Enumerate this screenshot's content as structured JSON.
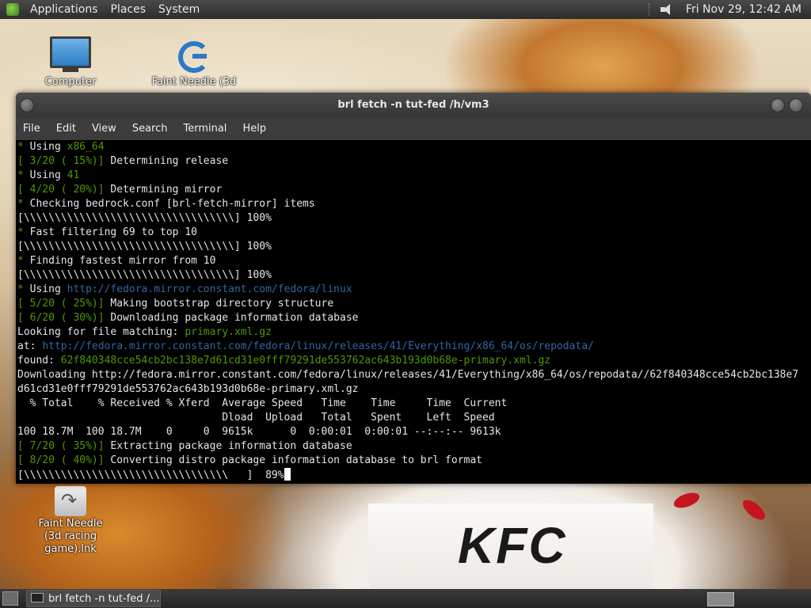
{
  "top_panel": {
    "menus": [
      "Applications",
      "Places",
      "System"
    ],
    "clock": "Fri Nov 29, 12:42 AM",
    "volume_icon": "speaker-icon"
  },
  "desktop_icons": [
    {
      "label": "Computer",
      "icon": "computer-icon"
    },
    {
      "label": "Faint Needle (3d",
      "icon": "app-logo-icon"
    },
    {
      "label": "Faint Needle (3d racing game).lnk",
      "icon": "shortcut-icon"
    }
  ],
  "wallpaper": {
    "brand_text": "KFC"
  },
  "window": {
    "title": "brl fetch -n tut-fed /h/vm3",
    "menus": [
      "File",
      "Edit",
      "View",
      "Search",
      "Terminal",
      "Help"
    ]
  },
  "terminal": {
    "lines": [
      [
        {
          "t": "* ",
          "c": "g"
        },
        {
          "t": "Using "
        },
        {
          "t": "x86_64",
          "c": "g"
        }
      ],
      [
        {
          "t": "[ 3/20 ( 15%)]",
          "c": "g"
        },
        {
          "t": " Determining release"
        }
      ],
      [
        {
          "t": "* ",
          "c": "g"
        },
        {
          "t": "Using "
        },
        {
          "t": "41",
          "c": "g"
        }
      ],
      [
        {
          "t": "[ 4/20 ( 20%)]",
          "c": "g"
        },
        {
          "t": " Determining mirror"
        }
      ],
      [
        {
          "t": "* ",
          "c": "g"
        },
        {
          "t": "Checking bedrock.conf [brl-fetch-mirror] items"
        }
      ],
      [
        {
          "t": "[\\\\\\\\\\\\\\\\\\\\\\\\\\\\\\\\\\\\\\\\\\\\\\\\\\\\\\\\\\\\\\\\\\\\] 100%"
        }
      ],
      [
        {
          "t": "* ",
          "c": "g"
        },
        {
          "t": "Fast filtering 69 to top 10"
        }
      ],
      [
        {
          "t": "[\\\\\\\\\\\\\\\\\\\\\\\\\\\\\\\\\\\\\\\\\\\\\\\\\\\\\\\\\\\\\\\\\\\\] 100%"
        }
      ],
      [
        {
          "t": "* ",
          "c": "g"
        },
        {
          "t": "Finding fastest mirror from 10"
        }
      ],
      [
        {
          "t": "[\\\\\\\\\\\\\\\\\\\\\\\\\\\\\\\\\\\\\\\\\\\\\\\\\\\\\\\\\\\\\\\\\\\\] 100%"
        }
      ],
      [
        {
          "t": "* ",
          "c": "g"
        },
        {
          "t": "Using "
        },
        {
          "t": "http://fedora.mirror.constant.com/fedora/linux",
          "c": "b"
        }
      ],
      [
        {
          "t": "[ 5/20 ( 25%)]",
          "c": "g"
        },
        {
          "t": " Making bootstrap directory structure"
        }
      ],
      [
        {
          "t": "[ 6/20 ( 30%)]",
          "c": "g"
        },
        {
          "t": " Downloading package information database"
        }
      ],
      [
        {
          "t": "Looking for file matching: "
        },
        {
          "t": "primary.xml.gz",
          "c": "g"
        }
      ],
      [
        {
          "t": "at: "
        },
        {
          "t": "http://fedora.mirror.constant.com/fedora/linux/releases/41/Everything/x86_64/os/repodata/",
          "c": "b"
        }
      ],
      [
        {
          "t": "found: "
        },
        {
          "t": "62f840348cce54cb2bc138e7d61cd31e0fff79291de553762ac643b193d0b68e-primary.xml.gz",
          "c": "g"
        }
      ],
      [
        {
          "t": "Downloading http://fedora.mirror.constant.com/fedora/linux/releases/41/Everything/x86_64/os/repodata//62f840348cce54cb2bc138e7"
        }
      ],
      [
        {
          "t": "d61cd31e0fff79291de553762ac643b193d0b68e-primary.xml.gz"
        }
      ],
      [
        {
          "t": "  % Total    % Received % Xferd  Average Speed   Time    Time     Time  Current"
        }
      ],
      [
        {
          "t": "                                 Dload  Upload   Total   Spent    Left  Speed"
        }
      ],
      [
        {
          "t": "100 18.7M  100 18.7M    0     0  9615k      0  0:00:01  0:00:01 --:--:-- 9613k"
        }
      ],
      [
        {
          "t": "[ 7/20 ( 35%)]",
          "c": "g"
        },
        {
          "t": " Extracting package information database"
        }
      ],
      [
        {
          "t": "[ 8/20 ( 40%)]",
          "c": "g"
        },
        {
          "t": " Converting distro package information database to brl format"
        }
      ],
      [
        {
          "t": "[\\\\\\\\\\\\\\\\\\\\\\\\\\\\\\\\\\\\\\\\\\\\\\\\\\\\\\\\\\\\\\\\\\   ]  89%"
        }
      ]
    ]
  },
  "taskbar": {
    "task_label": "brl fetch -n tut-fed /..."
  },
  "colors": {
    "green": "#4e9a06",
    "blue": "#3465a4",
    "terminal_bg": "#000000"
  }
}
